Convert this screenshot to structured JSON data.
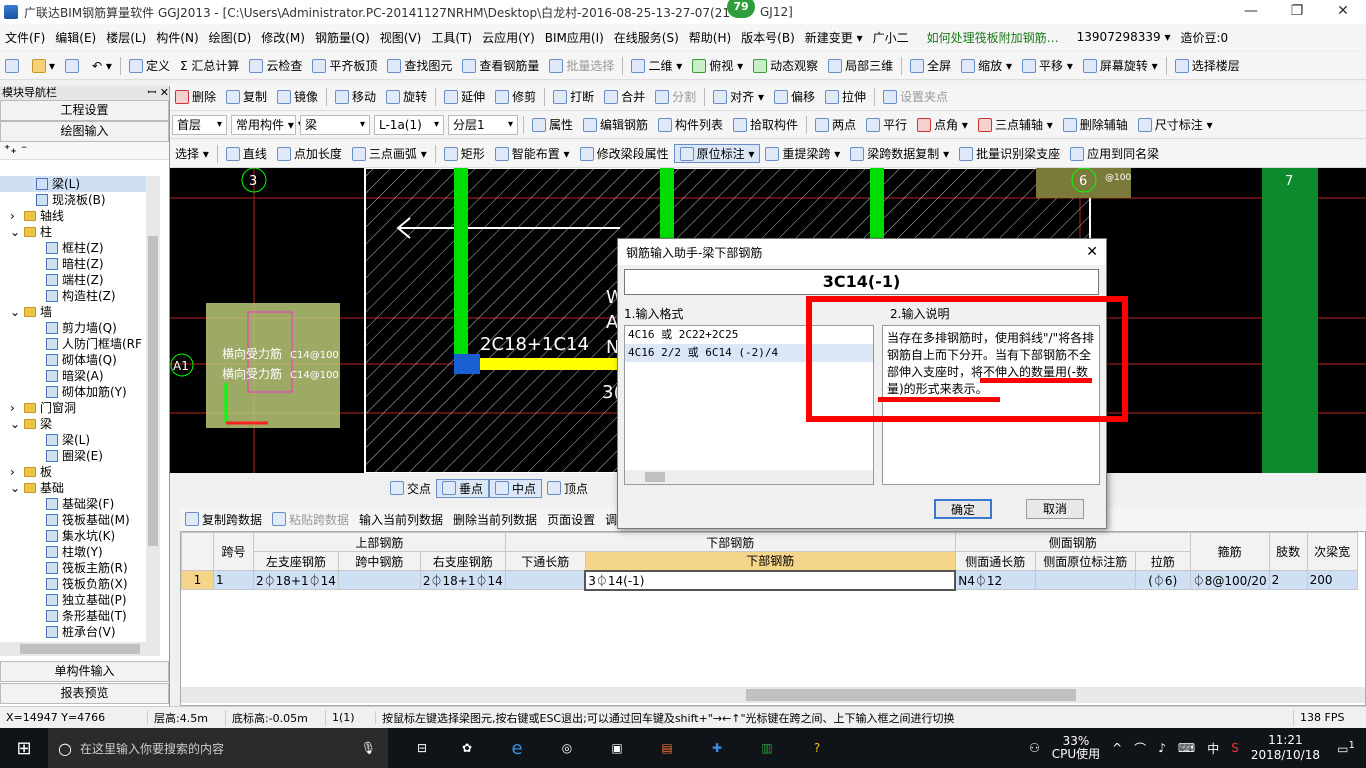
{
  "window": {
    "title": "广联达BIM钢筋算量软件 GGJ2013 - [C:\\Users\\Administrator.PC-20141127NRHM\\Desktop\\白龙村-2016-08-25-13-27-07(21",
    "title_tail": "GJ12]",
    "badge": "79",
    "min": "—",
    "max": "❐",
    "close": "✕"
  },
  "menu": {
    "items": [
      "文件(F)",
      "编辑(E)",
      "楼层(L)",
      "构件(N)",
      "绘图(D)",
      "修改(M)",
      "钢筋量(Q)",
      "视图(V)",
      "工具(T)",
      "云应用(Y)",
      "BIM应用(I)",
      "在线服务(S)",
      "帮助(H)",
      "版本号(B)",
      "新建变更 ▾",
      "广小二",
      "如何处理筏板附加钢筋…",
      "13907298339 ▾",
      "造价豆:0"
    ]
  },
  "toolbar1": {
    "items": [
      "定义",
      "Σ 汇总计算",
      "云检查",
      "平齐板顶",
      "查找图元",
      "查看钢筋量",
      "批量选择",
      "二维 ▾",
      "俯视 ▾",
      "动态观察",
      "局部三维",
      "全屏",
      "缩放 ▾",
      "平移 ▾",
      "屏幕旋转 ▾",
      "选择楼层"
    ]
  },
  "toolbar2": {
    "items": [
      "删除",
      "复制",
      "镜像",
      "移动",
      "旋转",
      "延伸",
      "修剪",
      "打断",
      "合并",
      "分割",
      "对齐 ▾",
      "偏移",
      "拉伸",
      "设置夹点"
    ]
  },
  "toolbar3": {
    "floor": "首层",
    "comp_type": "常用构件 ▾",
    "comp_sub": "梁",
    "comp_name": "L-1a(1)",
    "layer": "分层1",
    "items": [
      "属性",
      "编辑钢筋",
      "构件列表",
      "拾取构件",
      "两点",
      "平行",
      "点角 ▾",
      "三点辅轴 ▾",
      "删除辅轴",
      "尺寸标注 ▾"
    ]
  },
  "toolbar4": {
    "items": [
      "选择 ▾",
      "直线",
      "点加长度",
      "三点画弧 ▾",
      "矩形",
      "智能布置 ▾",
      "修改梁段属性",
      "原位标注 ▾",
      "重提梁跨 ▾",
      "梁跨数据复制 ▾",
      "批量识别梁支座",
      "应用到同名梁"
    ]
  },
  "sidebar": {
    "header": "模块导航栏",
    "pin": "ꟷ ✕",
    "btn_settings": "工程设置",
    "btn_draw": "绘图输入",
    "btn_single": "单构件输入",
    "btn_report": "报表预览",
    "tree": [
      {
        "label": "梁(L)",
        "lvl": 3,
        "type": "item"
      },
      {
        "label": "现浇板(B)",
        "lvl": 3,
        "type": "item"
      },
      {
        "label": "轴线",
        "lvl": 1,
        "type": "folder",
        "exp": "›"
      },
      {
        "label": "柱",
        "lvl": 1,
        "type": "folder",
        "exp": "⌄"
      },
      {
        "label": "框柱(Z)",
        "lvl": 3,
        "type": "item"
      },
      {
        "label": "暗柱(Z)",
        "lvl": 3,
        "type": "item"
      },
      {
        "label": "端柱(Z)",
        "lvl": 3,
        "type": "item"
      },
      {
        "label": "构造柱(Z)",
        "lvl": 3,
        "type": "item"
      },
      {
        "label": "墙",
        "lvl": 1,
        "type": "folder",
        "exp": "⌄"
      },
      {
        "label": "剪力墙(Q)",
        "lvl": 3,
        "type": "item"
      },
      {
        "label": "人防门框墙(RF",
        "lvl": 3,
        "type": "item"
      },
      {
        "label": "砌体墙(Q)",
        "lvl": 3,
        "type": "item"
      },
      {
        "label": "暗梁(A)",
        "lvl": 3,
        "type": "item"
      },
      {
        "label": "砌体加筋(Y)",
        "lvl": 3,
        "type": "item"
      },
      {
        "label": "门窗洞",
        "lvl": 1,
        "type": "folder",
        "exp": "›"
      },
      {
        "label": "梁",
        "lvl": 1,
        "type": "folder",
        "exp": "⌄"
      },
      {
        "label": "梁(L)",
        "lvl": 3,
        "type": "item"
      },
      {
        "label": "圈梁(E)",
        "lvl": 3,
        "type": "item"
      },
      {
        "label": "板",
        "lvl": 1,
        "type": "folder",
        "exp": "›"
      },
      {
        "label": "基础",
        "lvl": 1,
        "type": "folder",
        "exp": "⌄"
      },
      {
        "label": "基础梁(F)",
        "lvl": 3,
        "type": "item"
      },
      {
        "label": "筏板基础(M)",
        "lvl": 3,
        "type": "item"
      },
      {
        "label": "集水坑(K)",
        "lvl": 3,
        "type": "item"
      },
      {
        "label": "柱墩(Y)",
        "lvl": 3,
        "type": "item"
      },
      {
        "label": "筏板主筋(R)",
        "lvl": 3,
        "type": "item"
      },
      {
        "label": "筏板负筋(X)",
        "lvl": 3,
        "type": "item"
      },
      {
        "label": "独立基础(P)",
        "lvl": 3,
        "type": "item"
      },
      {
        "label": "条形基础(T)",
        "lvl": 3,
        "type": "item"
      },
      {
        "label": "桩承台(V)",
        "lvl": 3,
        "type": "item"
      }
    ]
  },
  "canvas": {
    "axis3": "3",
    "axis6": "6",
    "axis7": "7",
    "axisA1": "A1",
    "beam_label": "2C18+1C14",
    "col_text1": "横向受力筋",
    "col_text2": "横向受力筋",
    "side_text1": "C14@100",
    "side_text2": "C14@100",
    "frag1": "W",
    "frag2": "A",
    "frag3": "N",
    "frag4": "3(",
    "side_num": "@100"
  },
  "snap": {
    "items": [
      "交点",
      "垂点",
      "中点",
      "顶点"
    ]
  },
  "dialog": {
    "title": "钢筋输入助手-梁下部钢筋",
    "close": "✕",
    "value": "3C14(-1)",
    "format_label": "1.输入格式",
    "desc_label": "2.输入说明",
    "formats": [
      "4C16 或 2C22+2C25",
      "4C16 2/2 或 6C14 (-2)/4"
    ],
    "description": "当存在多排钢筋时，使用斜线\"/\"将各排钢筋自上而下分开。当有下部钢筋不全部伸入支座时，将不伸入的数量用(-数量)的形式来表示。",
    "ok": "确定",
    "cancel": "取消"
  },
  "gridtoolbar": {
    "items": [
      "复制跨数据",
      "粘贴跨数据",
      "输入当前列数据",
      "删除当前列数据",
      "页面设置",
      "调"
    ]
  },
  "grid": {
    "h_span": "跨号",
    "h_top": "上部钢筋",
    "h_bottom": "下部钢筋",
    "h_side": "侧面钢筋",
    "h_stirrup": "箍筋",
    "h_legs": "肢数",
    "h_sec": "次梁宽",
    "sub": [
      "左支座钢筋",
      "跨中钢筋",
      "右支座钢筋",
      "下通长筋",
      "下部钢筋",
      "侧面通长筋",
      "侧面原位标注筋",
      "拉筋"
    ],
    "row": {
      "idx": "1",
      "span": "1",
      "left": "2⏀18+1⏀14",
      "mid": "",
      "right": "2⏀18+1⏀14",
      "through": "",
      "bottom": "3⏀14(-1)",
      "side_through": "N4⏀12",
      "side_orig": "",
      "tie": "(⏀6)",
      "stirrup": "⏀8@100/20",
      "legs": "2",
      "sec": "200"
    }
  },
  "status": {
    "coords": "X=14947 Y=4766",
    "floor_h": "层高:4.5m",
    "base_h": "底标高:-0.05m",
    "count": "1(1)",
    "hint": "按鼠标左键选择梁图元,按右键或ESC退出;可以通过回车键及shift+\"→←↑\"光标键在跨之间、上下输入框之间进行切换",
    "fps": "138 FPS"
  },
  "taskbar": {
    "search": "在这里输入你要搜索的内容",
    "cpu": "33%",
    "cpu_label": "CPU使用",
    "time": "11:21",
    "date": "2018/10/18",
    "ime": "中",
    "notif": "1"
  },
  "colors": {
    "accent": "#ff0000",
    "beam_yellow": "#ffff00",
    "green_bar": "#00dd00"
  }
}
